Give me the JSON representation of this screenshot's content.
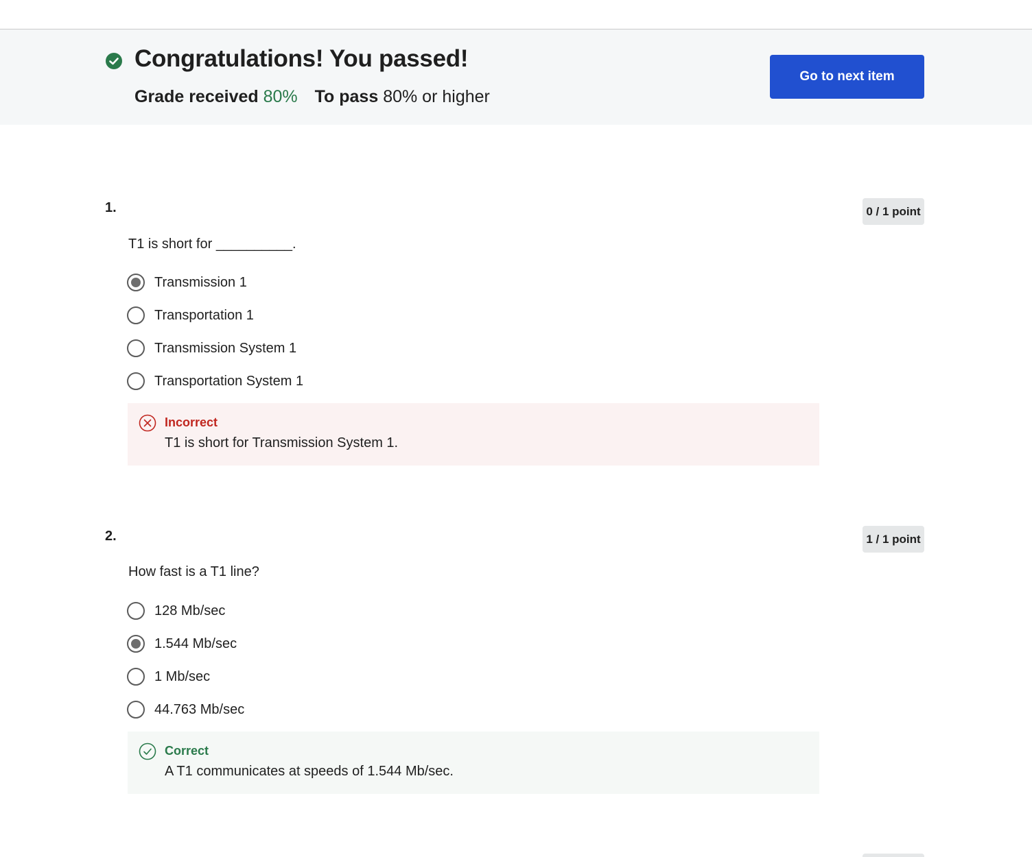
{
  "banner": {
    "title": "Congratulations! You passed!",
    "grade_label": "Grade received",
    "grade_value": "80%",
    "pass_label": "To pass",
    "pass_value": "80% or higher",
    "next_button": "Go to next item",
    "icon": "check-circle-icon",
    "accent_green": "#2a7a4b",
    "button_color": "#2150d0"
  },
  "questions": [
    {
      "number": "1.",
      "points": "0 / 1 point",
      "text": "T1 is short for __________.",
      "options": [
        {
          "label": "Transmission 1",
          "selected": true
        },
        {
          "label": "Transportation 1",
          "selected": false
        },
        {
          "label": "Transmission System 1",
          "selected": false
        },
        {
          "label": "Transportation System 1",
          "selected": false
        }
      ],
      "feedback": {
        "status": "Incorrect",
        "text": "T1 is short for Transmission System 1.",
        "icon": "x-circle-icon",
        "color": "#c0261f"
      }
    },
    {
      "number": "2.",
      "points": "1 / 1 point",
      "text": "How fast is a T1 line?",
      "options": [
        {
          "label": "128 Mb/sec",
          "selected": false
        },
        {
          "label": "1.544 Mb/sec",
          "selected": true
        },
        {
          "label": "1 Mb/sec",
          "selected": false
        },
        {
          "label": "44.763 Mb/sec",
          "selected": false
        }
      ],
      "feedback": {
        "status": "Correct",
        "text": "A T1 communicates at speeds of 1.544 Mb/sec.",
        "icon": "check-circle-outline-icon",
        "color": "#2a7a4b"
      }
    }
  ]
}
